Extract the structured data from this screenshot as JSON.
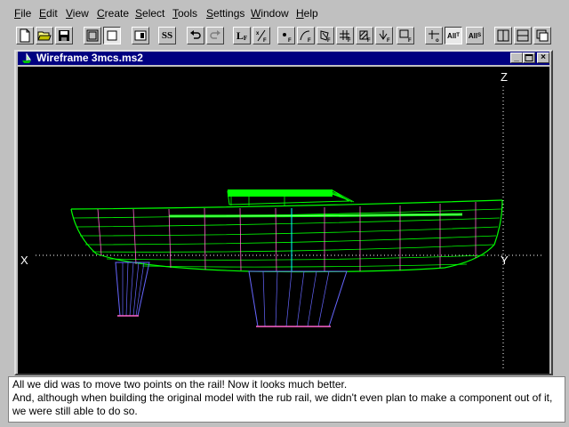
{
  "menu": [
    {
      "label": "File",
      "ul": "F",
      "rest": "ile"
    },
    {
      "label": "Edit",
      "ul": "E",
      "rest": "dit"
    },
    {
      "label": "View",
      "ul": "V",
      "rest": "iew"
    },
    {
      "label": "Create",
      "ul": "C",
      "rest": "reate"
    },
    {
      "label": "Select",
      "ul": "S",
      "rest": "elect"
    },
    {
      "label": "Tools",
      "ul": "T",
      "rest": "ools"
    },
    {
      "label": "Settings",
      "ul": "S",
      "rest": "ettings"
    },
    {
      "label": "Window",
      "ul": "W",
      "rest": "indow"
    },
    {
      "label": "Help",
      "ul": "H",
      "rest": "elp"
    }
  ],
  "toolbar": {
    "ss_label": "SS",
    "lf_label": "L",
    "all_t_label": "All",
    "all_s_label": "All"
  },
  "window": {
    "title": "Wireframe 3mcs.ms2"
  },
  "axes": {
    "x": "X",
    "y": "Y",
    "z": "Z"
  },
  "caption": {
    "line1": "All we did was to move two points on the rail! Now it looks much better.",
    "line2": "And, although when building the original model with the rub rail, we didn't even plan to make a component out of it, we were still able to do so."
  },
  "colors": {
    "title_bar": "#000080",
    "viewport_bg": "#000000",
    "hull_green": "#00ff00",
    "hull_pink": "#ff66cc",
    "hull_cyan": "#00ffff",
    "keel_blue": "#6666ff"
  }
}
